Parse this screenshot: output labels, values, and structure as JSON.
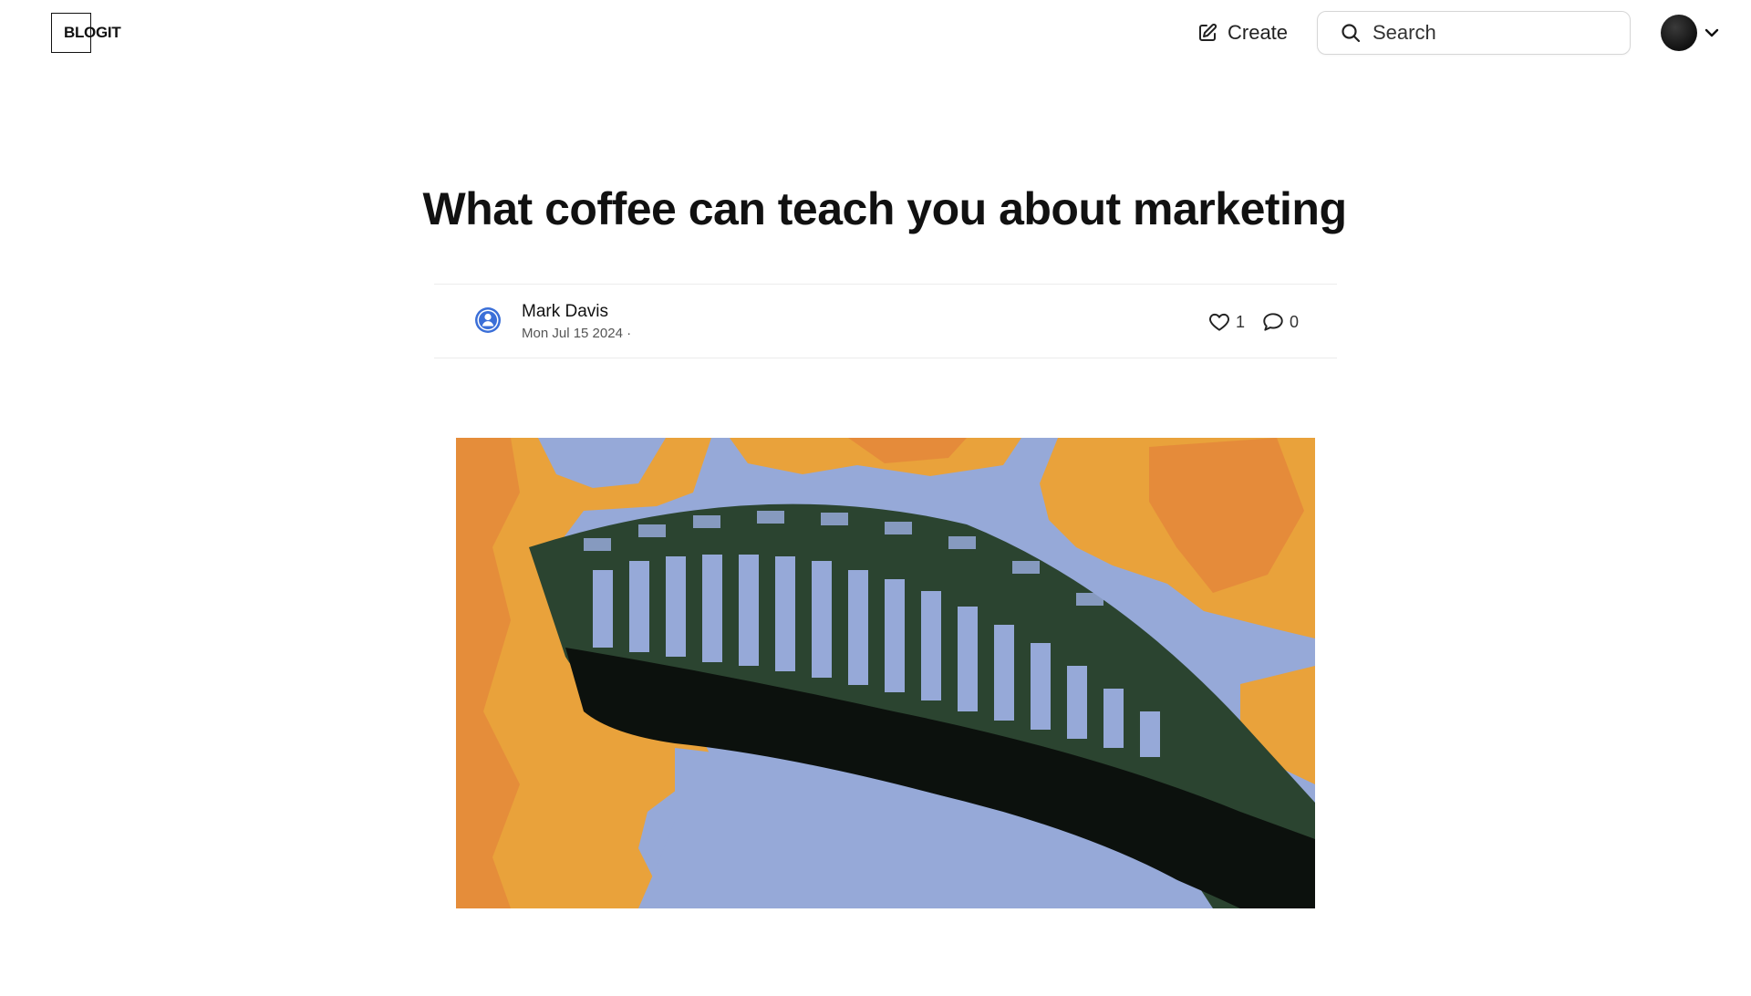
{
  "header": {
    "logo_text": "BLOGIT",
    "create_label": "Create",
    "search_placeholder": "Search"
  },
  "article": {
    "title": "What coffee can teach you about marketing",
    "author": "Mark Davis",
    "date": "Mon Jul 15 2024 ·",
    "likes": "1",
    "comments": "0"
  },
  "icons": {
    "create": "pencil-square-icon",
    "search": "magnifier-icon",
    "menu": "chevron-down-icon",
    "author": "user-circle-icon",
    "likes": "heart-icon",
    "comments": "speech-bubble-icon"
  },
  "colors": {
    "accent_blue": "#3b6fd8",
    "image_sky": "#96a9d8",
    "image_foliage": "#e9a23b",
    "image_bridge": "#2b4430"
  }
}
